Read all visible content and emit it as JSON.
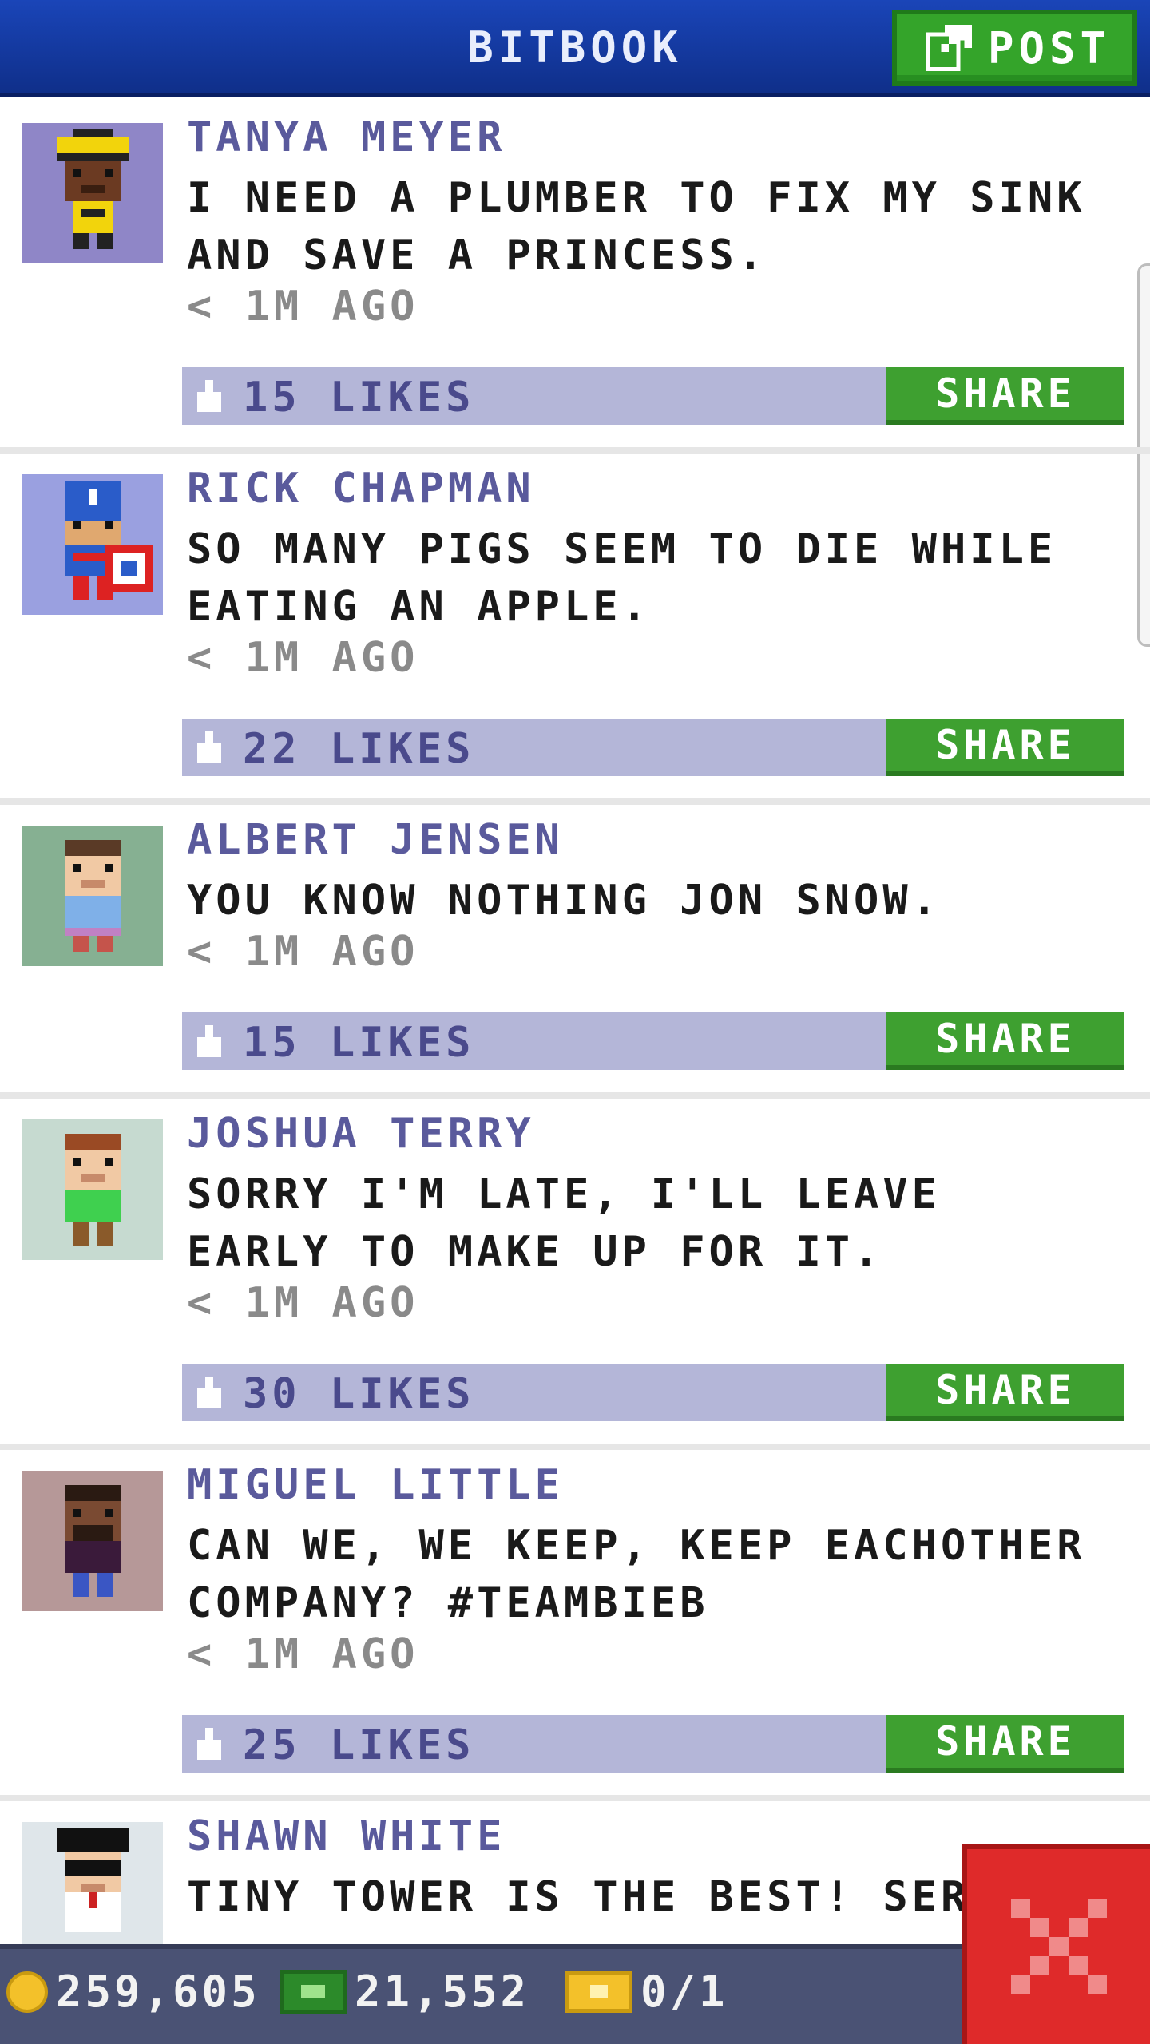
{
  "header": {
    "title": "BITBOOK",
    "post_label": "POST"
  },
  "posts": [
    {
      "author": "TANYA MEYER",
      "text": "I NEED A PLUMBER TO FIX MY SINK AND SAVE A PRINCESS.",
      "time": "< 1M AGO",
      "likes": "15 LIKES",
      "share": "SHARE",
      "avatar_bg": "#8f86c7"
    },
    {
      "author": "RICK CHAPMAN",
      "text": "SO MANY PIGS SEEM TO DIE WHILE EATING AN APPLE.",
      "time": "< 1M AGO",
      "likes": "22 LIKES",
      "share": "SHARE",
      "avatar_bg": "#9aa0e0"
    },
    {
      "author": "ALBERT JENSEN",
      "text": "YOU KNOW NOTHING JON SNOW.",
      "time": "< 1M AGO",
      "likes": "15 LIKES",
      "share": "SHARE",
      "avatar_bg": "#86b092"
    },
    {
      "author": "JOSHUA TERRY",
      "text": "SORRY I'M LATE, I'LL LEAVE EARLY TO MAKE UP FOR IT.",
      "time": "< 1M AGO",
      "likes": "30 LIKES",
      "share": "SHARE",
      "avatar_bg": "#c6dad0"
    },
    {
      "author": "MIGUEL LITTLE",
      "text": "CAN WE, WE KEEP, KEEP EACHOTHER COMPANY? #TEAMBIEB",
      "time": "< 1M AGO",
      "likes": "25 LIKES",
      "share": "SHARE",
      "avatar_bg": "#b69898"
    },
    {
      "author": "SHAWN WHITE",
      "text": "TINY TOWER IS THE BEST! SERIOU",
      "time": "",
      "likes": "",
      "share": "",
      "avatar_bg": "#dfe6ea"
    }
  ],
  "status": {
    "coins": "259,605",
    "bux": "21,552",
    "vip": "0/1"
  },
  "icons": {
    "post": "edit-icon",
    "like": "thumbs-up-icon",
    "close": "close-icon",
    "coin": "coin-icon",
    "bux": "bux-icon",
    "vip": "vip-ticket-icon"
  },
  "colors": {
    "header": "#1a45b8",
    "accent_green": "#3ea030",
    "likes_bar": "#b4b6d8",
    "author": "#5a5a9c",
    "close_red": "#df2a2a"
  }
}
